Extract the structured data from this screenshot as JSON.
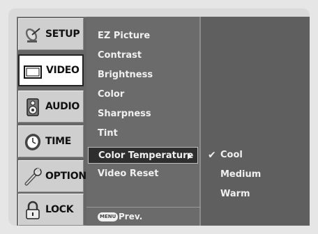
{
  "categories": [
    {
      "label": "SETUP",
      "icon": "satellite-dish-icon"
    },
    {
      "label": "VIDEO",
      "icon": "tv-screen-icon",
      "active": true
    },
    {
      "label": "AUDIO",
      "icon": "speaker-icon"
    },
    {
      "label": "TIME",
      "icon": "clock-icon"
    },
    {
      "label": "OPTION",
      "icon": "wrench-icon"
    },
    {
      "label": "LOCK",
      "icon": "padlock-icon"
    }
  ],
  "submenu": {
    "items": [
      "EZ Picture",
      "Contrast",
      "Brightness",
      "Color",
      "Sharpness",
      "Tint",
      "Color Temperature",
      "Video Reset"
    ],
    "selected_index": 6
  },
  "options": {
    "items": [
      "Cool",
      "Medium",
      "Warm"
    ],
    "checked_index": 0,
    "check_glyph": "✔"
  },
  "footer": {
    "menu_badge": "MENU",
    "prev_label": "Prev."
  }
}
